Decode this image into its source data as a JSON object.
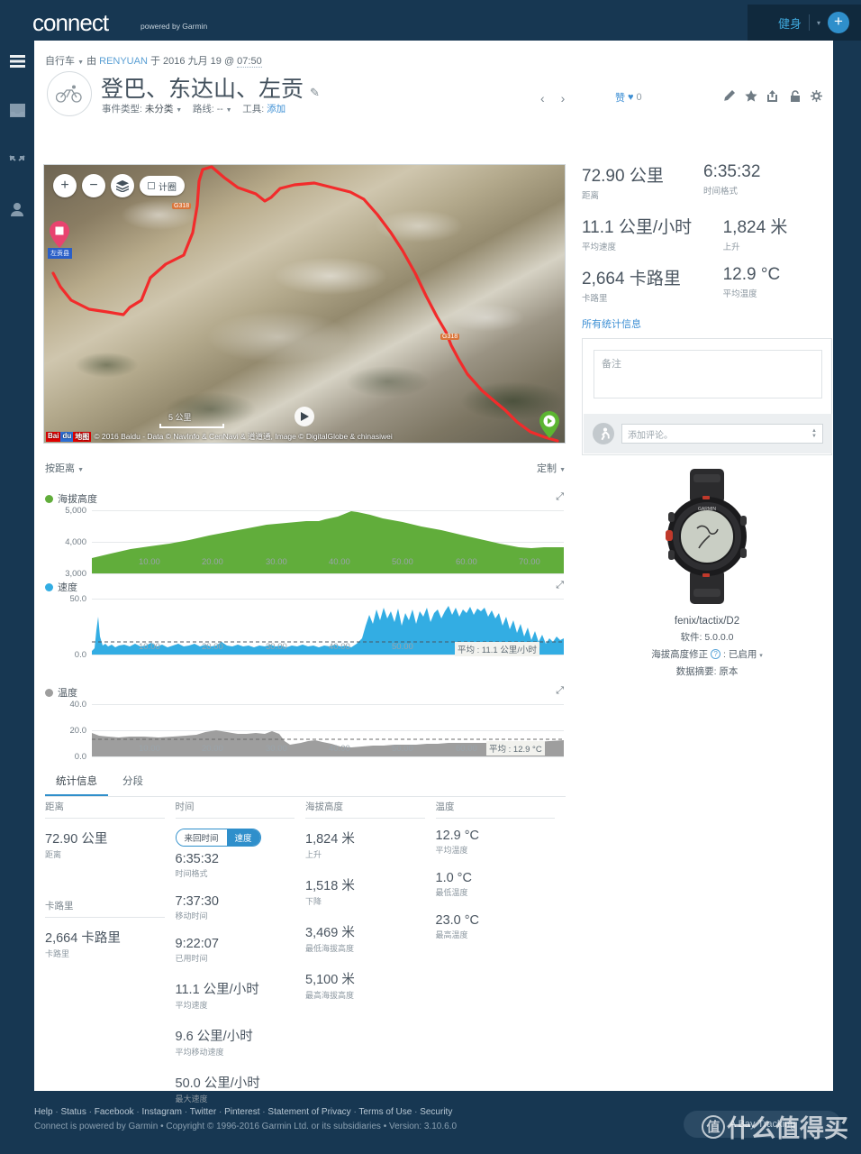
{
  "topbar": {
    "logo": "connect",
    "logo_sub": "powered by Garmin",
    "fitness_label": "健身",
    "plus_label": "+"
  },
  "rail": {
    "items": [
      {
        "icon": "hamburger-menu-icon",
        "name": "menu"
      },
      {
        "icon": "inbox-icon",
        "name": "inbox"
      },
      {
        "icon": "connections-icon",
        "name": "connections"
      },
      {
        "icon": "profile-icon",
        "name": "profile"
      }
    ]
  },
  "activity": {
    "type": "自行车",
    "by_prefix": "由",
    "user": "RENYUAN",
    "on_prefix": "于",
    "date": "2016 九月 19",
    "at": "@",
    "time": "07:50",
    "title": "登巴、东达山、左贡",
    "event_type_label": "事件类型:",
    "event_type_value": "未分类",
    "route_label": "路线:",
    "route_value": "--",
    "tools_label": "工具:",
    "tools_link": "添加",
    "like_label": "赞",
    "like_count": "0"
  },
  "map": {
    "zoom_in": "+",
    "zoom_out": "−",
    "layers_icon": "layers-icon",
    "measure_label": "计圈",
    "scale_text": "5 公里",
    "attribution": "© 2016 Baidu - Data © NavInfo & CenNavi & 道道通, Image © DigitalGlobe & chinasiwei",
    "baidu_a": "Bai",
    "baidu_b": "du",
    "baidu_c": "地图",
    "road_labels": [
      "G318",
      "G318"
    ]
  },
  "stats_summary": {
    "rows": [
      [
        {
          "value": "72.90 公里",
          "label": "距离"
        },
        {
          "value": "6:35:32",
          "label": "时间格式"
        }
      ],
      [
        {
          "value": "11.1 公里/小时",
          "label": "平均速度"
        },
        {
          "value": "1,824 米",
          "label": "上升"
        }
      ],
      [
        {
          "value": "2,664 卡路里",
          "label": "卡路里"
        },
        {
          "value": "12.9 °C",
          "label": "平均温度"
        }
      ]
    ],
    "all_stats_link": "所有统计信息"
  },
  "notes": {
    "placeholder": "备注",
    "comment_placeholder": "添加评论。"
  },
  "device": {
    "name": "fenix/tactix/D2",
    "software_label": "软件:",
    "software_value": "5.0.0.0",
    "elev_correction_label": "海拔高度修正",
    "elev_correction_value": ": 已启用",
    "data_summary_label": "数据摘要:",
    "data_summary_value": "原本"
  },
  "chart_controls": {
    "x_mode": "按距离",
    "customize": "定制"
  },
  "chart_data": [
    {
      "type": "area",
      "title": "海拔高度",
      "color": "#61ad3b",
      "xlabel": "",
      "ylabel": "",
      "ylim": [
        3000,
        5000
      ],
      "yticks": [
        "3,000",
        "4,000",
        "5,000"
      ],
      "xticks": [
        "10.00",
        "20.00",
        "30.00",
        "40.00",
        "50.00",
        "60.00",
        "70.00"
      ],
      "x": [
        0,
        3,
        6,
        9,
        12,
        15,
        18,
        21,
        24,
        27,
        30,
        33,
        35,
        36,
        38,
        40,
        41,
        43,
        45,
        48,
        51,
        54,
        57,
        60,
        63,
        66,
        68,
        70,
        72.9
      ],
      "values": [
        3470,
        3620,
        3760,
        3860,
        3950,
        4060,
        4180,
        4300,
        4420,
        4520,
        4600,
        4660,
        4650,
        4720,
        4800,
        4960,
        4930,
        4870,
        4760,
        4620,
        4500,
        4380,
        4240,
        4100,
        3950,
        3820,
        3790,
        3800,
        3810
      ]
    },
    {
      "type": "area",
      "title": "速度",
      "color": "#33ade3",
      "xlabel": "",
      "ylabel": "",
      "ylim": [
        0,
        50
      ],
      "yticks": [
        "0.0",
        "50.0"
      ],
      "xticks": [
        "10.00",
        "20.00",
        "30.00",
        "40.00",
        "50.00",
        "60.00",
        "70.00"
      ],
      "average_line": 11.1,
      "annotation": "平均 : 11.1 公里/小时",
      "x": [
        0,
        1,
        2,
        4,
        6,
        8,
        10,
        13,
        16,
        19,
        22,
        25,
        28,
        31,
        34,
        37,
        40,
        42,
        43,
        45,
        47,
        49,
        51,
        53,
        55,
        57,
        59,
        61,
        63,
        65,
        67,
        69,
        71,
        72.9
      ],
      "values": [
        3,
        22,
        8,
        7,
        6,
        7,
        6,
        8,
        6,
        7,
        9,
        6,
        7,
        5,
        6,
        6,
        7,
        12,
        26,
        40,
        36,
        42,
        32,
        38,
        34,
        42,
        44,
        41,
        40,
        38,
        26,
        14,
        10,
        12
      ]
    },
    {
      "type": "area",
      "title": "温度",
      "color": "#9e9e9e",
      "xlabel": "",
      "ylabel": "",
      "ylim": [
        0,
        40
      ],
      "yticks": [
        "0.0",
        "20.0",
        "40.0"
      ],
      "xticks": [
        "10.00",
        "20.00",
        "30.00",
        "40.00",
        "50.00",
        "60.00"
      ],
      "average_line": 12.9,
      "annotation": "平均 : 12.9 °C",
      "x": [
        0,
        2,
        5,
        8,
        11,
        14,
        17,
        20,
        23,
        26,
        29,
        30,
        32,
        34,
        36,
        38,
        40,
        43,
        46,
        49,
        52,
        55,
        58,
        61,
        64,
        67,
        70,
        72.9
      ],
      "values": [
        18,
        15,
        15,
        15,
        15,
        16,
        16,
        17,
        19,
        17,
        17,
        13,
        9,
        10,
        12,
        11,
        9,
        8,
        8,
        9,
        9,
        10,
        11,
        12,
        12,
        12,
        12,
        13
      ]
    }
  ],
  "tabs": [
    {
      "label": "统计信息",
      "active": true
    },
    {
      "label": "分段",
      "active": false
    }
  ],
  "stats_table": {
    "columns": [
      {
        "header": "距离",
        "items": [
          {
            "value": "72.90 公里",
            "label": "距离"
          }
        ],
        "header2": "卡路里",
        "items2": [
          {
            "value": "2,664 卡路里",
            "label": "卡路里"
          }
        ]
      },
      {
        "header": "时间",
        "toggle_off": "来回时间",
        "toggle_on": "速度",
        "items": [
          {
            "value": "6:35:32",
            "label": "时间格式"
          },
          {
            "value": "7:37:30",
            "label": "移动时间"
          },
          {
            "value": "9:22:07",
            "label": "已用时间"
          },
          {
            "value": "11.1 公里/小时",
            "label": "平均速度"
          },
          {
            "value": "9.6 公里/小时",
            "label": "平均移动速度"
          },
          {
            "value": "50.0 公里/小时",
            "label": "最大速度"
          }
        ]
      },
      {
        "header": "海拔高度",
        "items": [
          {
            "value": "1,824 米",
            "label": "上升"
          },
          {
            "value": "1,518 米",
            "label": "下降"
          },
          {
            "value": "3,469 米",
            "label": "最低海拔高度"
          },
          {
            "value": "5,100 米",
            "label": "最高海拔高度"
          }
        ]
      },
      {
        "header": "温度",
        "items": [
          {
            "value": "12.9 °C",
            "label": "平均温度"
          },
          {
            "value": "1.0 °C",
            "label": "最低温度"
          },
          {
            "value": "23.0 °C",
            "label": "最高温度"
          }
        ]
      }
    ]
  },
  "footer": {
    "links": [
      "Help",
      "Status",
      "Facebook",
      "Instagram",
      "Twitter",
      "Pinterest",
      "Statement of Privacy",
      "Terms of Use",
      "Security"
    ],
    "copyright": "Connect is powered by Garmin • Copyright © 1996-2016 Garmin Ltd. or its subsidiaries • Version: 3.10.6.0",
    "back_to_top": "A Bay Tracking",
    "watermark": "什么值得买"
  }
}
